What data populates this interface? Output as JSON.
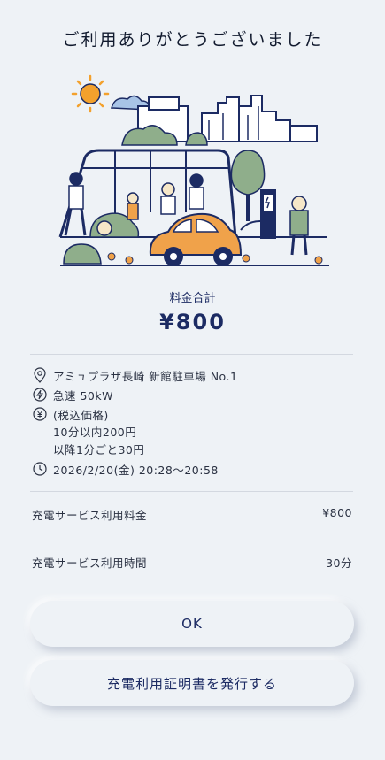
{
  "header": {
    "title": "ご利用ありがとうございました"
  },
  "fee": {
    "label": "料金合計",
    "amount": "¥800"
  },
  "details": {
    "location": "アミュプラザ長崎 新館駐車場 No.1",
    "charger": "急速 50kW",
    "price_title": "(税込価格)",
    "price_line1": "10分以内200円",
    "price_line2": "以降1分ごと30円",
    "datetime": "2026/2/20(金) 20:28～20:58"
  },
  "summary": {
    "fee_label": "充電サービス利用料金",
    "fee_value": "¥800",
    "time_label": "充電サービス利用時間",
    "time_value": "30分"
  },
  "buttons": {
    "ok": "OK",
    "certificate": "充電利用証明書を発行する"
  },
  "colors": {
    "navy": "#1c2b63",
    "orange": "#f0a24a",
    "green": "#8fae8b",
    "sun": "#f3a12d",
    "background": "#eef2f6"
  },
  "icons": [
    "location-pin-icon",
    "lightning-icon",
    "yen-icon",
    "clock-icon"
  ]
}
